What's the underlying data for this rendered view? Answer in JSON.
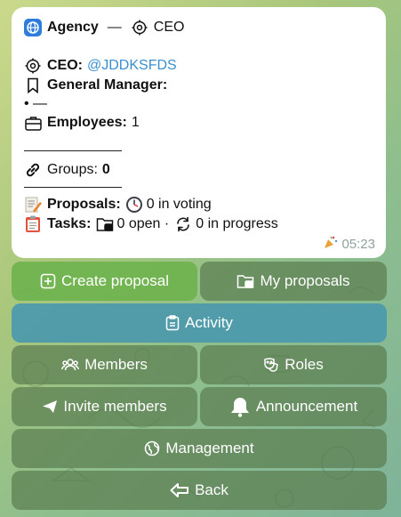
{
  "message": {
    "agency_label": "Agency",
    "dash": "—",
    "role_label": "CEO",
    "ceo_label": "CEO:",
    "ceo_handle": "@JDDKSFDS",
    "gm_label": "General Manager:",
    "gm_value": "• —",
    "employees_label": "Employees:",
    "employees_count": "1",
    "groups_label": "Groups:",
    "groups_count": "0",
    "proposals_label": "Proposals:",
    "proposals_value": "0 in voting",
    "tasks_label": "Tasks:",
    "tasks_open": "0 open ·",
    "tasks_progress": "0 in progress",
    "time": "05:23"
  },
  "buttons": {
    "create_proposal": "Create proposal",
    "my_proposals": "My proposals",
    "activity": "Activity",
    "members": "Members",
    "roles": "Roles",
    "invite_members": "Invite members",
    "announcement": "Announcement",
    "management": "Management",
    "back": "Back"
  },
  "colors": {
    "create_proposal_bg": "#6fb34e",
    "activity_bg": "#4e9aac",
    "default_btn_bg": "#6f8f5f",
    "link": "#3a8fd0",
    "globe_badge": "#2f7ddb"
  }
}
